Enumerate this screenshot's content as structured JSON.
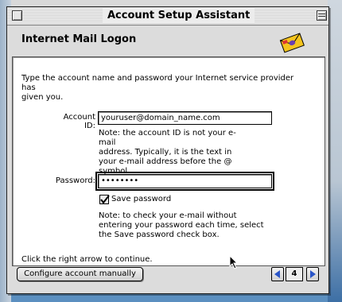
{
  "window": {
    "title": "Account Setup Assistant"
  },
  "page": {
    "title": "Internet Mail Logon"
  },
  "intro": "Type the account name and password your Internet service provider has\ngiven you.",
  "account": {
    "label": "Account ID:",
    "value": "youruser@domain_name.com",
    "note": "Note: the account ID is not your e-mail\naddress. Typically, it is the text in\nyour e-mail address before the @\nsymbol."
  },
  "password": {
    "label": "Password:",
    "value": "••••••••",
    "save_label": "Save password",
    "save_checked": true,
    "note": "Note: to check your e-mail without\nentering your password each time, select\nthe Save password check box."
  },
  "continue_text": "Click the right arrow to continue.",
  "buttons": {
    "manual": "Configure account manually"
  },
  "nav": {
    "page_number": "4"
  }
}
